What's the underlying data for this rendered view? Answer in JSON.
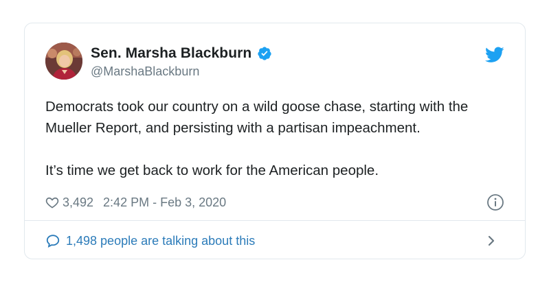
{
  "colors": {
    "twitter_blue": "#1da1f2",
    "link_blue": "#2b7bb9",
    "text": "#1c2022",
    "muted": "#697882",
    "border": "#e1e8ed"
  },
  "author": {
    "display_name": "Sen. Marsha Blackburn",
    "handle": "@MarshaBlackburn",
    "verified": true,
    "avatar_icon": "profile-photo"
  },
  "tweet": {
    "paragraphs": [
      "Democrats took our country on a wild goose chase, starting with the Mueller Report, and persisting with a partisan impeachment.",
      "It’s time we get back to work for the American people."
    ]
  },
  "meta": {
    "likes": "3,492",
    "timestamp": "2:42 PM - Feb 3, 2020",
    "like_icon": "heart-icon",
    "info_icon": "info-icon"
  },
  "footer": {
    "talking_text": "1,498 people are talking about this",
    "bubble_icon": "speech-bubble-icon",
    "chevron_icon": "chevron-right-icon"
  },
  "brand_icon": "twitter-bird-icon"
}
